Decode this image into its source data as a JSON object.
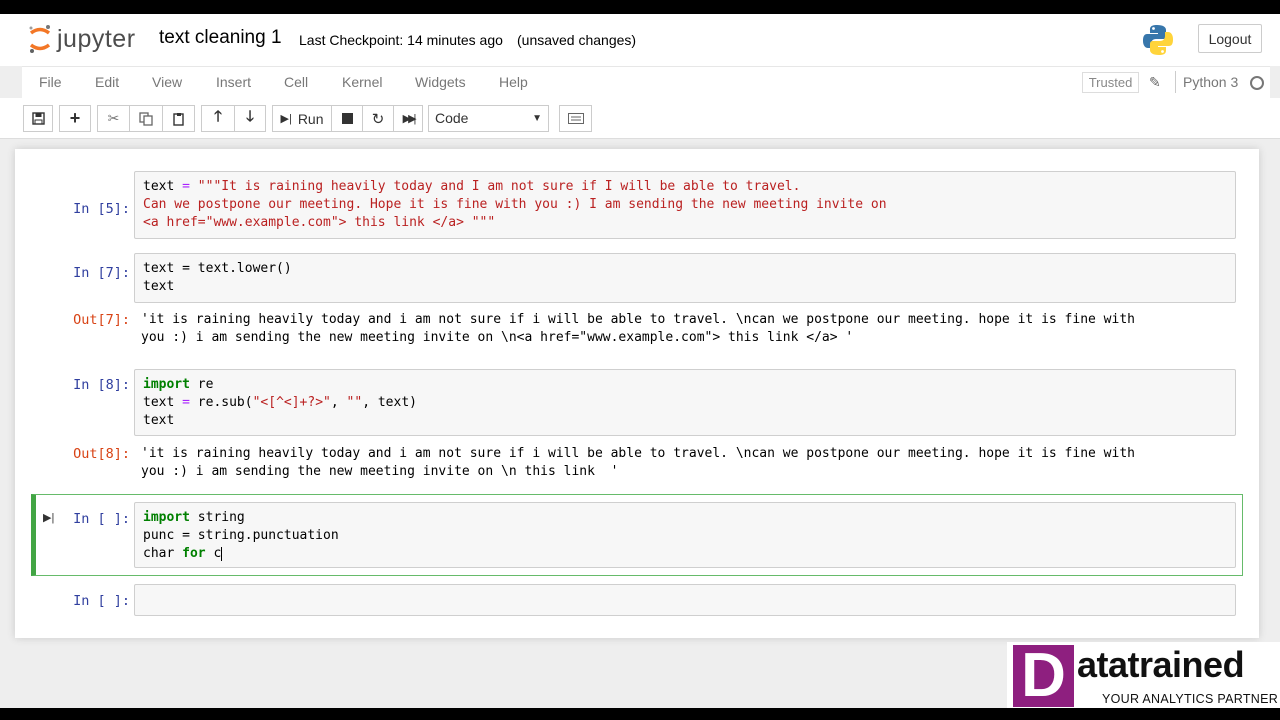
{
  "header": {
    "logo_text": "jupyter",
    "notebook_name": "text cleaning 1",
    "checkpoint": "Last Checkpoint: 14 minutes ago",
    "unsaved": "(unsaved changes)",
    "logout_label": "Logout"
  },
  "menubar": {
    "items": [
      "File",
      "Edit",
      "View",
      "Insert",
      "Cell",
      "Kernel",
      "Widgets",
      "Help"
    ],
    "trusted": "Trusted",
    "kernel": "Python 3"
  },
  "toolbar": {
    "run_label": "Run",
    "cell_type": "Code"
  },
  "cells": [
    {
      "prompt": "In [5]:",
      "lines": [
        "text = \"\"\"It is raining heavily today and I am not sure if I will be able to travel.",
        "Can we postpone our meeting. Hope it is fine with you :) I am sending the new meeting invite on",
        "<a href=\"www.example.com\"> this link </a> \"\"\""
      ]
    },
    {
      "prompt": "In [7]:",
      "lines": [
        "text = text.lower()",
        "text"
      ],
      "out_prompt": "Out[7]:",
      "out_lines": [
        "'it is raining heavily today and i am not sure if i will be able to travel. \\ncan we postpone our meeting. hope it is fine with",
        "you :) i am sending the new meeting invite on \\n<a href=\"www.example.com\"> this link </a> '"
      ]
    },
    {
      "prompt": "In [8]:",
      "lines": [
        "import re",
        "text = re.sub(\"<[^<]+?>\", \"\", text)",
        "text"
      ],
      "out_prompt": "Out[8]:",
      "out_lines": [
        "'it is raining heavily today and i am not sure if i will be able to travel. \\ncan we postpone our meeting. hope it is fine with",
        "you :) i am sending the new meeting invite on \\n this link  '"
      ]
    },
    {
      "prompt": "In [ ]:",
      "lines": [
        "import string",
        "punc = string.punctuation",
        "char for c"
      ]
    },
    {
      "prompt": "In [ ]:",
      "lines": []
    }
  ],
  "watermark": {
    "letter": "D",
    "brand": "atatrained",
    "tagline": "YOUR ANALYTICS PARTNER"
  },
  "colors": {
    "prompt_in": "#303f9f",
    "prompt_out": "#d84315",
    "keyword": "#008000",
    "string": "#ba2121",
    "selected_border": "#42a544",
    "brand": "#8e1f7f"
  }
}
